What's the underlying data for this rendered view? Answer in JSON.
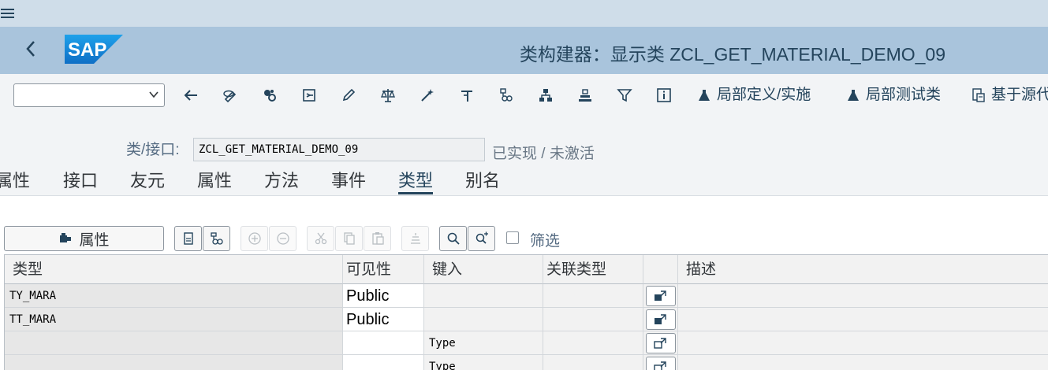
{
  "shell": {
    "title": "类构建器：显示类 ZCL_GET_MATERIAL_DEMO_09",
    "logo_text": "SAP"
  },
  "toolbar": {
    "command_field_value": "",
    "local_def_label": "局部定义/实施",
    "local_test_label": "局部测试类",
    "source_label": "基于源代"
  },
  "header": {
    "class_label": "类/接口:",
    "class_value": "ZCL_GET_MATERIAL_DEMO_09",
    "status": "已实现 / 未激活"
  },
  "tabs": [
    {
      "label": "属性"
    },
    {
      "label": "接口"
    },
    {
      "label": "友元"
    },
    {
      "label": "属性"
    },
    {
      "label": "方法"
    },
    {
      "label": "事件"
    },
    {
      "label": "类型",
      "selected": true
    },
    {
      "label": "别名"
    }
  ],
  "table_toolbar": {
    "attributes_button": "属性",
    "filter_label": "筛选"
  },
  "grid": {
    "columns": [
      "类型",
      "可见性",
      "键入",
      "关联类型",
      "",
      "描述"
    ],
    "rows": [
      {
        "type": "TY_MARA",
        "visibility": "Public",
        "typing": "",
        "assoc": "",
        "desc": "",
        "filled": true
      },
      {
        "type": "TT_MARA",
        "visibility": "Public",
        "typing": "",
        "assoc": "",
        "desc": "",
        "filled": true
      },
      {
        "type": "",
        "visibility": "",
        "typing": "Type",
        "assoc": "",
        "desc": "",
        "filled": false
      },
      {
        "type": "",
        "visibility": "",
        "typing": "Type",
        "assoc": "",
        "desc": "",
        "filled": false
      }
    ]
  },
  "colors": {
    "shell_bg": "#a9c4dc",
    "topbar_bg": "#cfdde9",
    "sap_blue": "#1e8ede",
    "text_dark": "#24445c"
  }
}
